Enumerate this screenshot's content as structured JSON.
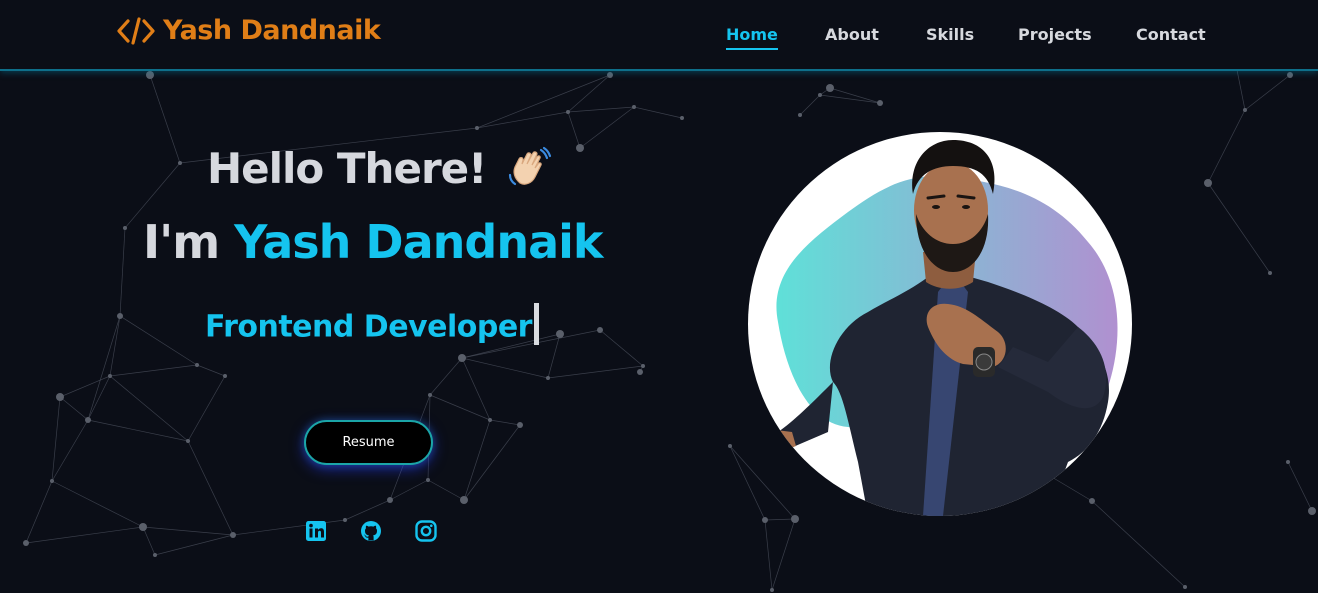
{
  "navbar": {
    "brand": "Yash Dandnaik",
    "brand_icon": "code-brackets-icon",
    "links": [
      {
        "label": "Home",
        "active": true
      },
      {
        "label": "About",
        "active": false
      },
      {
        "label": "Skills",
        "active": false
      },
      {
        "label": "Projects",
        "active": false
      },
      {
        "label": "Contact",
        "active": false
      }
    ]
  },
  "hero": {
    "greeting": "Hello There!",
    "greeting_icon": "waving-hand-icon",
    "intro_prefix": "I'm",
    "name": "Yash Dandnaik",
    "role": "Frontend Developer",
    "resume_label": "Resume",
    "socials": [
      {
        "name": "linkedin",
        "icon": "linkedin-icon"
      },
      {
        "name": "github",
        "icon": "github-icon"
      },
      {
        "name": "instagram",
        "icon": "instagram-icon"
      }
    ]
  },
  "colors": {
    "background": "#0b0e17",
    "accent": "#15c4ef",
    "brand": "#e07e17",
    "text": "#d6d8de"
  }
}
